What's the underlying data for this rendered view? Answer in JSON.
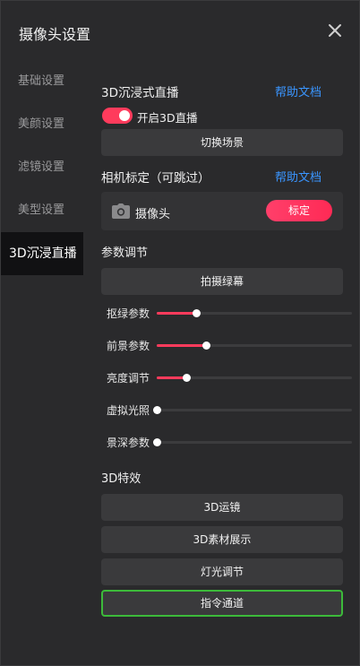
{
  "window": {
    "title": "摄像头设置",
    "close_icon": "close-icon"
  },
  "sidebar": {
    "items": [
      {
        "label": "基础设置",
        "active": false
      },
      {
        "label": "美颜设置",
        "active": false
      },
      {
        "label": "滤镜设置",
        "active": false
      },
      {
        "label": "美型设置",
        "active": false
      },
      {
        "label": "3D沉浸直播",
        "active": true
      }
    ]
  },
  "immersive": {
    "title": "3D沉浸式直播",
    "help_label": "帮助文档",
    "toggle_label": "开启3D直播",
    "toggle_on": true,
    "switch_scene_label": "切换场景"
  },
  "camera_calibration": {
    "title": "相机标定（可跳过）",
    "help_label": "帮助文档",
    "camera_label": "摄像头",
    "camera_icon": "camera-icon",
    "calibrate_label": "标定"
  },
  "params": {
    "title": "参数调节",
    "shoot_green_label": "拍摄绿幕",
    "sliders": [
      {
        "label": "抠绿参数",
        "value": 0.2
      },
      {
        "label": "前景参数",
        "value": 0.25
      },
      {
        "label": "亮度调节",
        "value": 0.15
      },
      {
        "label": "虚拟光照",
        "value": 0.0
      },
      {
        "label": "景深参数",
        "value": 0.0
      }
    ]
  },
  "effects": {
    "title": "3D特效",
    "buttons": [
      {
        "label": "3D运镜",
        "selected": false
      },
      {
        "label": "3D素材展示",
        "selected": false
      },
      {
        "label": "灯光调节",
        "selected": false
      },
      {
        "label": "指令通道",
        "selected": true
      }
    ]
  },
  "colors": {
    "accent": "#ff3b5c",
    "link": "#3a95ff",
    "selected_border": "#3cba3a",
    "background": "#2a2a2c"
  }
}
